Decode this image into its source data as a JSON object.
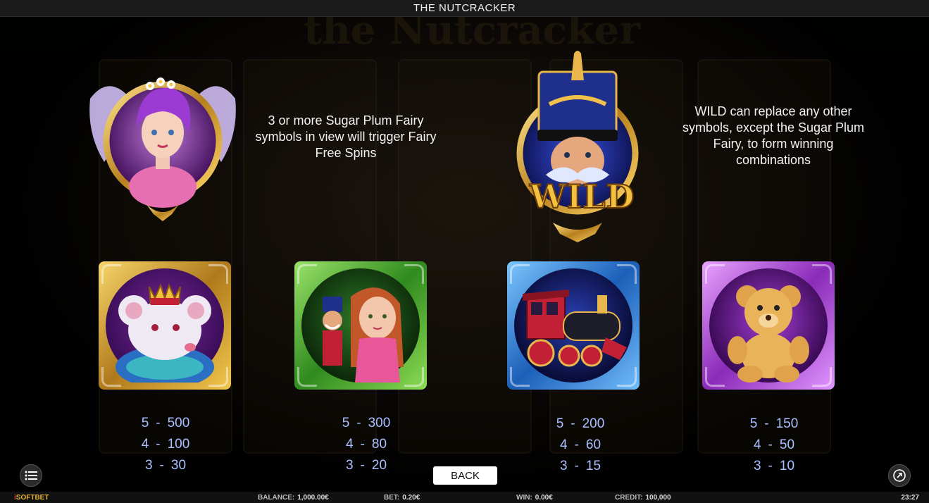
{
  "title": "THE NUTCRACKER",
  "background_title": "the Nutcracker",
  "scatter": {
    "icon": "sugar-plum-fairy",
    "description": "3 or more Sugar Plum Fairy symbols in view will trigger Fairy Free Spins"
  },
  "wild": {
    "icon": "nutcracker-wild",
    "badge": "WILD",
    "description": "WILD can replace any other symbols, except the Sugar Plum Fairy, to form winning combinations"
  },
  "symbols": [
    {
      "icon": "mouse-king-icon",
      "frame_color": "#e0b13a",
      "pays": [
        [
          "5",
          "500"
        ],
        [
          "4",
          "100"
        ],
        [
          "3",
          "30"
        ]
      ]
    },
    {
      "icon": "clara-icon",
      "frame_color": "#3aa02a",
      "pays": [
        [
          "5",
          "300"
        ],
        [
          "4",
          "80"
        ],
        [
          "3",
          "20"
        ]
      ]
    },
    {
      "icon": "toy-train-icon",
      "frame_color": "#2a7ad6",
      "pays": [
        [
          "5",
          "200"
        ],
        [
          "4",
          "60"
        ],
        [
          "3",
          "15"
        ]
      ]
    },
    {
      "icon": "teddy-bear-icon",
      "frame_color": "#b542e0",
      "pays": [
        [
          "5",
          "150"
        ],
        [
          "4",
          "50"
        ],
        [
          "3",
          "10"
        ]
      ]
    }
  ],
  "controls": {
    "back_label": "BACK",
    "menu_icon": "menu-icon",
    "share_icon": "external-link-icon"
  },
  "footer": {
    "brand_i": "i",
    "brand_rest": "SOFTBET",
    "balance_label": "BALANCE:",
    "balance_value": "1,000.00€",
    "bet_label": "BET:",
    "bet_value": "0.20€",
    "win_label": "WIN:",
    "win_value": "0.00€",
    "credit_label": "CREDIT:",
    "credit_value": "100,000",
    "time": "23:27"
  },
  "colors": {
    "paytable_text": "#aac0ff",
    "brand_red": "#d13a2a",
    "brand_yellow": "#e8b634"
  }
}
